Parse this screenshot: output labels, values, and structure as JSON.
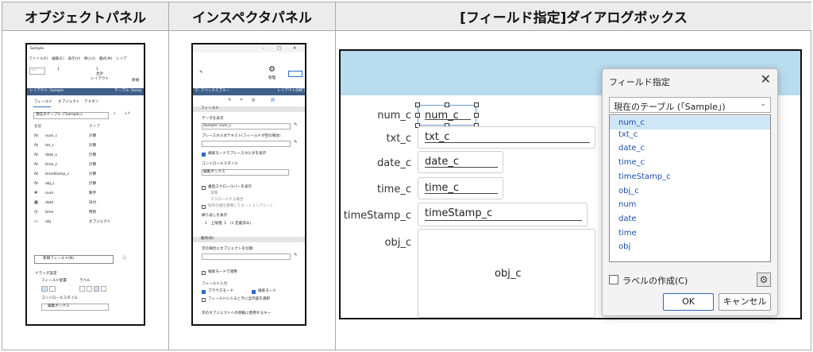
{
  "headers": {
    "object_panel": "オブジェクトパネル",
    "inspector_panel": "インスペクタパネル",
    "field_dialog": "[フィールド指定]ダイアログボックス"
  },
  "object_panel": {
    "title": "Sample",
    "menu": "ファイル(F)　編集(E)　表示(V)　挿入(I)　書式(M)　レイア",
    "record_num": "1",
    "record_total": "1",
    "record_total_label": "合計",
    "layout_label": "レイアウト",
    "new_label": "新規",
    "layout_bar": "レイアウト: Sample",
    "table_bar": "テーブル: Samp",
    "tabs": [
      "フィールド",
      "オブジェクト",
      "アドオン"
    ],
    "table_select": "現在のテーブル (「Sample」)",
    "col_name": "名前",
    "col_type": "タイプ",
    "fields": [
      {
        "icon": "fx",
        "name": "num_c",
        "type": "計算"
      },
      {
        "icon": "fx",
        "name": "txt_c",
        "type": "計算"
      },
      {
        "icon": "fx",
        "name": "date_c",
        "type": "計算"
      },
      {
        "icon": "fx",
        "name": "time_c",
        "type": "計算"
      },
      {
        "icon": "fx",
        "name": "timeStamp_c",
        "type": "計算"
      },
      {
        "icon": "fx",
        "name": "obj_c",
        "type": "計算"
      },
      {
        "icon": "#",
        "name": "num",
        "type": "数字"
      },
      {
        "icon": "▦",
        "name": "date",
        "type": "日付"
      },
      {
        "icon": "◷",
        "name": "time",
        "type": "時刻"
      },
      {
        "icon": "▭",
        "name": "obj",
        "type": "オブジェクト"
      }
    ],
    "new_field_button": "新規フィールド(N)",
    "drag_settings": "ドラッグ設定",
    "field_layout": "フィールド配置",
    "label": "ラベル",
    "control_style": "コントロールスタイル",
    "control_value": "編集ボックス"
  },
  "inspector_panel": {
    "manage_label": "管理",
    "style_bar": "マ: アベックスブルー",
    "exit_layout": "レイアウトの終了",
    "section_field": "フィールド",
    "show_data": "データを表示",
    "data_value": "Sample::num_c",
    "placeholder_label": "プレースホルダテキスト(フィールドが空の場合)",
    "find_placeholder": "検索モードでプレースホルダを表示",
    "control_style": "コントロールスタイル",
    "control_value": "編集ボックス",
    "vscroll": "垂直スクロールバーを表示",
    "opt1": "常時",
    "opt2": "スクロールする場合",
    "autocomplete": "既存の値を使用してオートコンプリート",
    "repeat_show": "繰り返しを表示",
    "repeat_value": "1　上限値: 1　(1 定義済み)",
    "section_behavior": "動作(B)",
    "next_object": "次の場合にオブジェクトを切替:",
    "find_mode": "検索モードで適用",
    "field_input": "フィールド入力",
    "browse_mode": "ブラウズモード",
    "search_mode": "検索モード",
    "select_all": "フィールドに入るときに全内容を選択",
    "next_key": "次のオブジェクトへの移動に使用するキー"
  },
  "form": {
    "fields": [
      {
        "label": "num_c",
        "value": "num_c"
      },
      {
        "label": "txt_c",
        "value": "txt_c"
      },
      {
        "label": "date_c",
        "value": "date_c"
      },
      {
        "label": "time_c",
        "value": "time_c"
      },
      {
        "label": "timeStamp_c",
        "value": "timeStamp_c"
      },
      {
        "label": "obj_c",
        "value": "obj_c"
      }
    ]
  },
  "dialog": {
    "title": "フィールド指定",
    "close": "✕",
    "table_select": "現在のテーブル (「Sample」)",
    "items": [
      "num_c",
      "txt_c",
      "date_c",
      "time_c",
      "timeStamp_c",
      "obj_c",
      "num",
      "date",
      "time",
      "obj"
    ],
    "selected_index": 0,
    "create_label": "ラベルの作成(C)",
    "ok": "OK",
    "cancel": "キャンセル"
  },
  "colors": {
    "header_bg": "#ececec",
    "form_header": "#b9dcee",
    "selection": "#cfe6f6",
    "list_text": "#1f4aa8",
    "checkbox_on": "#2b6cc4"
  }
}
